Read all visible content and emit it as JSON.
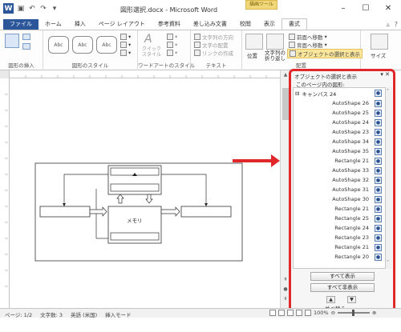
{
  "titlebar": {
    "title": "図形選択.docx - Microsoft Word",
    "context_group": "描画ツール",
    "app_icon": "W"
  },
  "tabs": [
    {
      "label": "ファイル"
    },
    {
      "label": "ホーム"
    },
    {
      "label": "挿入"
    },
    {
      "label": "ページ レイアウト"
    },
    {
      "label": "参考資料"
    },
    {
      "label": "差し込み文書"
    },
    {
      "label": "校閲"
    },
    {
      "label": "表示"
    },
    {
      "label": "書式"
    }
  ],
  "ribbon": {
    "group_insert": "図形の挿入",
    "group_styles": "図形のスタイル",
    "style_label": "Abc",
    "wordart_label": "クイック\nスタイル",
    "group_wordart": "ワードアートのスタイル",
    "text_dir": "文字列の方向",
    "text_align": "文字の配置",
    "create_link": "リンクの作成",
    "group_text": "テキスト",
    "position": "位置",
    "wrap": "文字列の\n折り返し",
    "bring_forward": "前面へ移動",
    "send_backward": "背面へ移動",
    "selection_pane": "オブジェクトの選択と表示",
    "group_arrange": "配置",
    "size": "サイズ"
  },
  "diagram": {
    "memo_label": "メモリ"
  },
  "pane": {
    "title": "オブジェクトの選択と表示",
    "subtitle": "このページ内の図形:",
    "root": "キャンバス 24",
    "items": [
      "AutoShape 26",
      "AutoShape 25",
      "AutoShape 24",
      "AutoShape 23",
      "AutoShape 34",
      "AutoShape 35",
      "Rectangle 21",
      "AutoShape 33",
      "AutoShape 32",
      "AutoShape 31",
      "AutoShape 30",
      "Rectangle 21",
      "Rectangle 25",
      "Rectangle 24",
      "Rectangle 23",
      "Rectangle 21",
      "Rectangle 20"
    ],
    "show_all": "すべて表示",
    "hide_all": "すべて非表示",
    "reorder": "並べ替え"
  },
  "statusbar": {
    "page": "ページ: 1/2",
    "words": "文字数: 3",
    "language": "英語 (米国)",
    "mode": "挿入モード",
    "zoom": "100%"
  },
  "colors": {
    "accent": "#2b579a",
    "highlight_red": "#e0282a",
    "arrow_red": "#e0282a"
  }
}
